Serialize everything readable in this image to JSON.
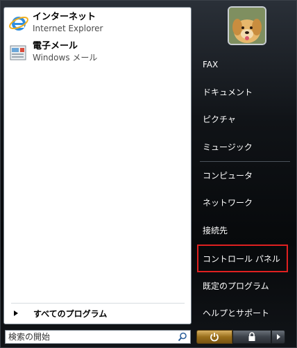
{
  "pinned": [
    {
      "title": "インターネット",
      "subtitle": "Internet Explorer",
      "icon": "ie-icon"
    },
    {
      "title": "電子メール",
      "subtitle": "Windows メール",
      "icon": "mail-icon"
    }
  ],
  "all_programs": {
    "label": "すべてのプログラム"
  },
  "search": {
    "placeholder": "検索の開始"
  },
  "right_menu": [
    {
      "label": "FAX"
    },
    {
      "label": "ドキュメント"
    },
    {
      "label": "ピクチャ"
    },
    {
      "label": "ミュージック"
    },
    {
      "label": "コンピュータ"
    },
    {
      "label": "ネットワーク"
    },
    {
      "label": "接続先"
    },
    {
      "label": "コントロール パネル"
    },
    {
      "label": "既定のプログラム"
    },
    {
      "label": "ヘルプとサポート"
    }
  ],
  "colors": {
    "highlight": "#e02020",
    "power": "#c08a2a"
  }
}
